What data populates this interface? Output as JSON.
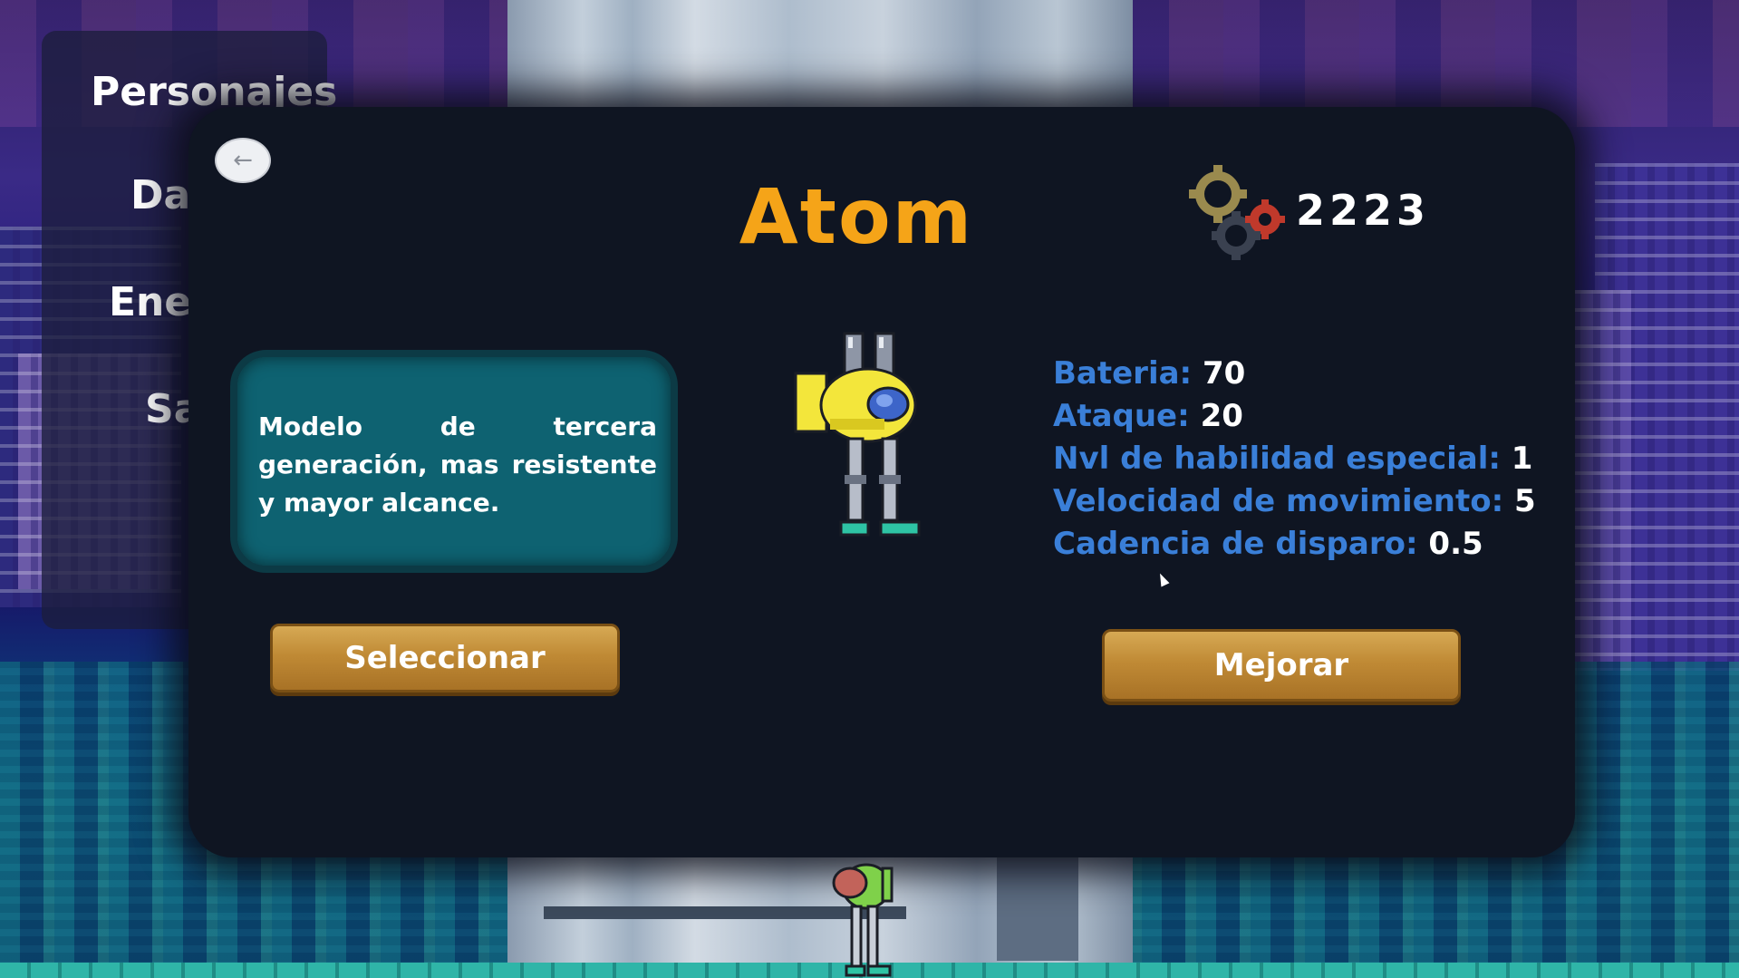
{
  "menu": {
    "items": [
      "Personajes",
      "Daños",
      "Enemigos",
      "Salir"
    ],
    "visible": [
      "Personajes",
      "Dañ",
      "Enem",
      "Sa"
    ],
    "behind_title": "Edificio de entrenamiento"
  },
  "character": {
    "name": "Atom",
    "description": "Modelo de tercera generación, mas resistente y mayor alcance."
  },
  "currency": {
    "icon": "gears-icon",
    "value": "2223"
  },
  "stats": [
    {
      "label": "Bateria:",
      "value": "70"
    },
    {
      "label": "Ataque:",
      "value": "20"
    },
    {
      "label": "Nvl de habilidad especial:",
      "value": "1"
    },
    {
      "label": "Velocidad de movimiento:",
      "value": "5"
    },
    {
      "label": "Cadencia de disparo:",
      "value": "0.5"
    }
  ],
  "buttons": {
    "select_label": "Seleccionar",
    "upgrade_label": "Mejorar",
    "back_icon": "arrow-left-icon"
  },
  "colors": {
    "title": "#f5a418",
    "stat_label": "#3a7fd8",
    "button_gold": "#c08a35",
    "desc_box": "#0e6271",
    "panel": "#0f1522"
  }
}
